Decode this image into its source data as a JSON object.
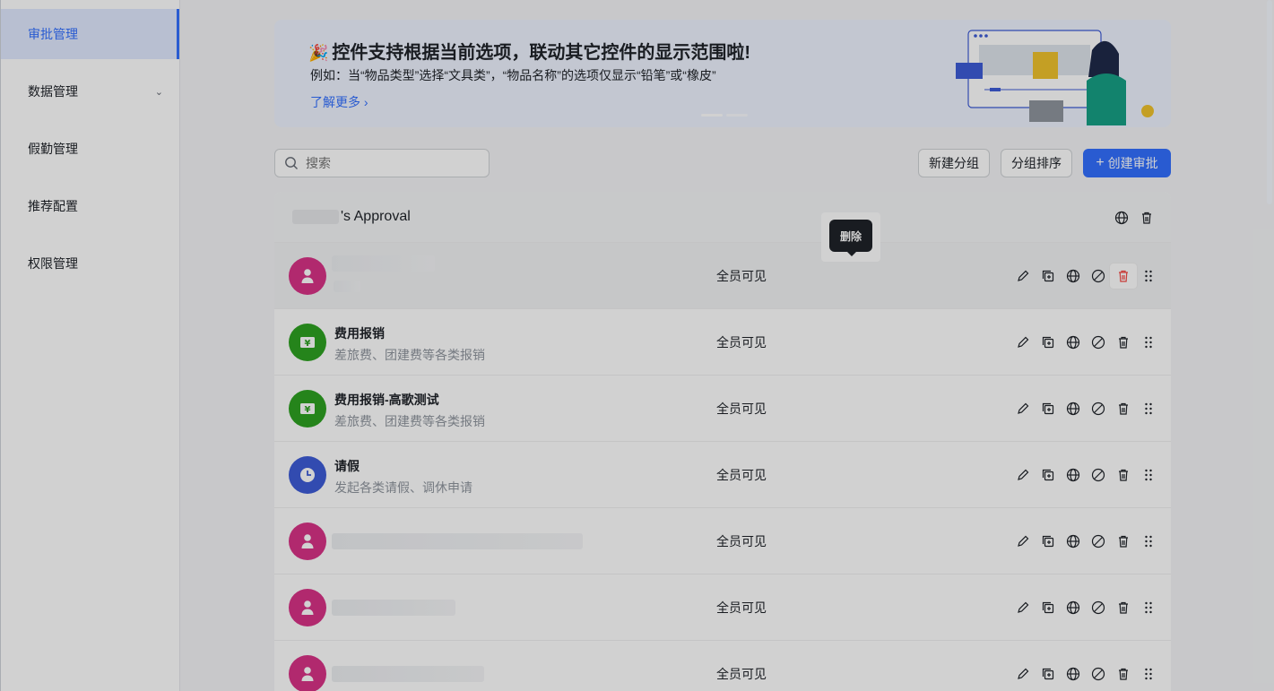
{
  "sidebar": {
    "items": [
      {
        "label": "审批管理",
        "active": true
      },
      {
        "label": "数据管理",
        "has_chevron": true
      },
      {
        "label": "假勤管理"
      },
      {
        "label": "推荐配置"
      },
      {
        "label": "权限管理"
      }
    ]
  },
  "banner": {
    "title": "控件支持根据当前选项，联动其它控件的显示范围啦!",
    "desc": "例如：当“物品类型”选择“文具类”，“物品名称”的选项仅显示“铅笔”或“橡皮”",
    "link": "了解更多"
  },
  "toolbar": {
    "search_placeholder": "搜索",
    "new_group": "新建分组",
    "sort_group": "分组排序",
    "create": "创建审批"
  },
  "group": {
    "title": "'s Approval"
  },
  "rows": [
    {
      "name": "",
      "desc": "",
      "visibility": "全员可见",
      "icon": "person-icon",
      "color": "#d83387"
    },
    {
      "name": "费用报销",
      "desc": "差旅费、团建费等各类报销",
      "visibility": "全员可见",
      "icon": "yen-icon",
      "color": "#2ea121"
    },
    {
      "name": "费用报销-高歌测试",
      "desc": "差旅费、团建费等各类报销",
      "visibility": "全员可见",
      "icon": "yen-icon",
      "color": "#2ea121"
    },
    {
      "name": "请假",
      "desc": "发起各类请假、调休申请",
      "visibility": "全员可见",
      "icon": "clock-icon",
      "color": "#3e5cd7"
    },
    {
      "name": "",
      "desc": "",
      "visibility": "全员可见",
      "icon": "person-icon",
      "color": "#d83387"
    },
    {
      "name": "",
      "desc": "",
      "visibility": "全员可见",
      "icon": "person-icon",
      "color": "#d83387"
    },
    {
      "name": "",
      "desc": "",
      "visibility": "全员可见",
      "icon": "person-icon",
      "color": "#d83387"
    }
  ],
  "tooltip": "删除",
  "colors": {
    "accent": "#3370ff",
    "danger": "#f54a45"
  }
}
